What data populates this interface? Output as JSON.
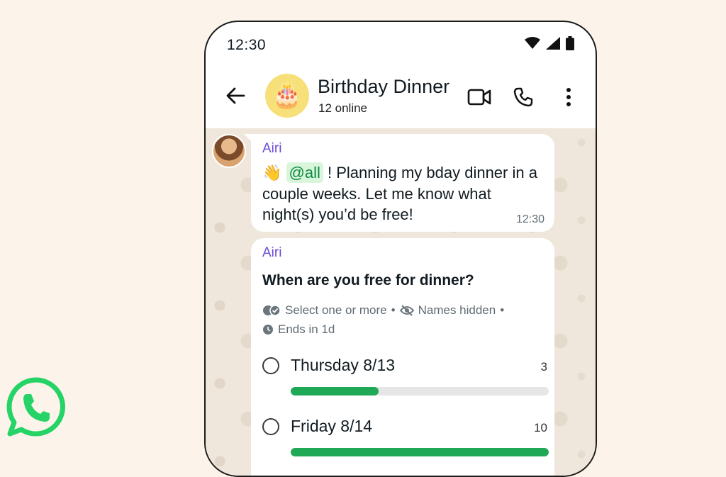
{
  "status_bar": {
    "time": "12:30"
  },
  "header": {
    "title": "Birthday Dinner",
    "subtitle": "12 online",
    "avatar_emoji": "🎂"
  },
  "messages": [
    {
      "sender": "Airi",
      "emoji": "👋",
      "mention": "@all",
      "text": " ! Planning my bday dinner in a couple weeks. Let me know what night(s) you’d be free!",
      "time": "12:30"
    }
  ],
  "poll": {
    "sender": "Airi",
    "question": "When are you free for dinner?",
    "meta_select": "Select one or more",
    "meta_names": "Names hidden",
    "meta_ends": "Ends in 1d",
    "separator": "•",
    "options": [
      {
        "label": "Thursday 8/13",
        "count": "3",
        "fraction": 0.34
      },
      {
        "label": "Friday 8/14",
        "count": "10",
        "fraction": 1.0
      }
    ]
  },
  "colors": {
    "accent_green": "#1fa855",
    "sender_purple": "#6b4cd6",
    "chat_background": "#efe7dc",
    "page_background": "#fcf4ea",
    "whatsapp_brand": "#25d366"
  }
}
